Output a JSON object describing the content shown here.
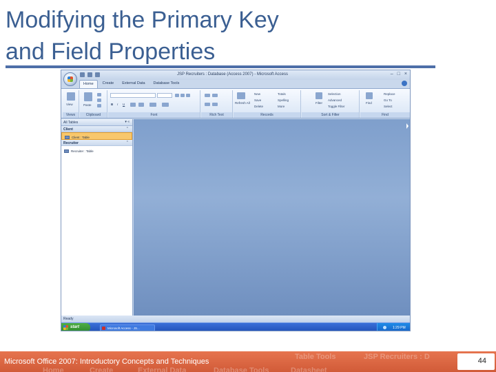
{
  "slide": {
    "title_line1": "Modifying the Primary Key",
    "title_line2": "and Field Properties",
    "footer_text": "Microsoft Office 2007: Introductory Concepts and Techniques",
    "page_number": "44",
    "footer_ghost_row1": [
      "Table Tools",
      "JSP Recruiters : D"
    ],
    "footer_ghost_row2": [
      "Home",
      "Create",
      "External Data",
      "Database Tools",
      "Datasheet"
    ]
  },
  "app": {
    "window_title": "JSP Recruiters : Database (Access 2007) - Microsoft Access",
    "window_controls": [
      "–",
      "□",
      "×"
    ],
    "tabs": [
      {
        "label": "Home",
        "active": true
      },
      {
        "label": "Create",
        "active": false
      },
      {
        "label": "External Data",
        "active": false
      },
      {
        "label": "Database Tools",
        "active": false
      }
    ],
    "ribbon_groups": {
      "views": {
        "label": "Views",
        "button": "View"
      },
      "clipboard": {
        "label": "Clipboard",
        "button": "Paste"
      },
      "font": {
        "label": "Font",
        "bold": "B",
        "italic": "I",
        "underline": "U"
      },
      "rich_text": {
        "label": "Rich Text"
      },
      "records": {
        "label": "Records",
        "refresh": "Refresh All",
        "new": "New",
        "save": "Save",
        "delete": "Delete",
        "totals": "Totals",
        "spelling": "Spelling",
        "more": "More"
      },
      "sort_filter": {
        "label": "Sort & Filter",
        "filter": "Filter",
        "selection": "Selection",
        "advanced": "Advanced",
        "toggle_filter": "Toggle Filter"
      },
      "find": {
        "label": "Find",
        "find": "Find",
        "replace": "Replace",
        "goto": "Go To",
        "select": "Select"
      }
    },
    "nav_pane": {
      "header": "All Tables",
      "groups": [
        {
          "name": "Client",
          "items": [
            {
              "label": "Client : Table",
              "selected": true
            }
          ]
        },
        {
          "name": "Recruiter",
          "items": [
            {
              "label": "Recruiter : Table",
              "selected": false
            }
          ]
        }
      ]
    },
    "status": "Ready"
  },
  "taskbar": {
    "start_label": "start",
    "task_label": "Microsoft Access - JS...",
    "clock": "1:29 PM"
  },
  "colors": {
    "title": "#3b5f92",
    "footer": "#d9623d",
    "selected_item": "#f8c76c",
    "workarea": "#7f9fcc"
  }
}
